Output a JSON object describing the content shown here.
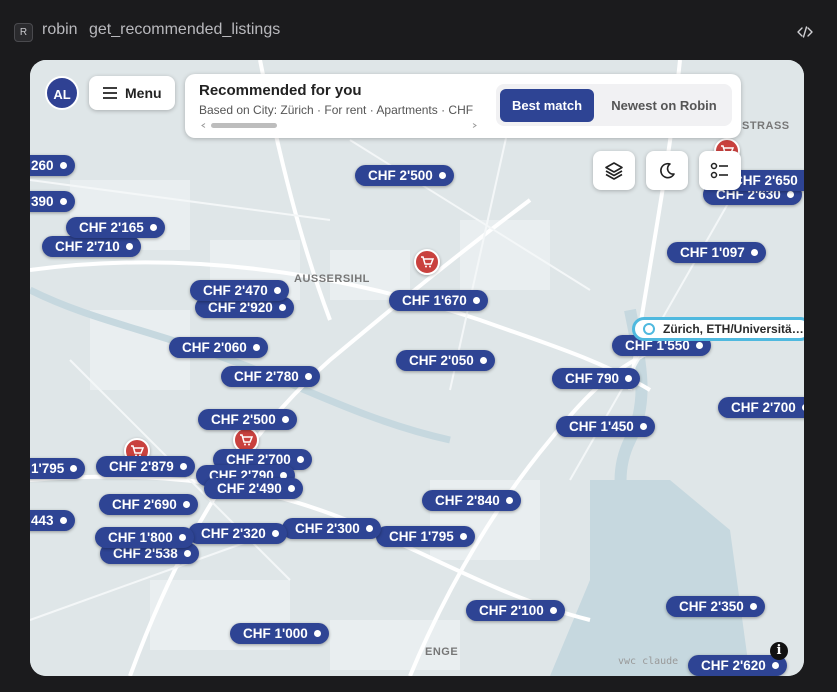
{
  "app": {
    "badge": "R",
    "name": "robin",
    "tool": "get_recommended_listings"
  },
  "map": {
    "avatar_initials": "AL",
    "menu_label": "Menu",
    "recommended": {
      "title": "Recommended for you",
      "subtitle": "Based on City: Zürich · For rent · Apartments · CHF"
    },
    "sort": {
      "active": "Best match",
      "other": "Newest on Robin"
    },
    "location_label": "Zürich, ETH/Universitä…",
    "areas": [
      "AUSSERSIHL",
      "ENGE",
      "STRASS"
    ],
    "attribution": "vwc claude",
    "price_pins": [
      "CHF 2'500",
      "CHF 1'670",
      "CHF 2'050",
      "CHF 1'550",
      "CHF 790",
      "CHF 1'450",
      "CHF 2'840",
      "CHF 1'795",
      "CHF 2'100",
      "CHF 1'000",
      "CHF 2'300",
      "CHF 2'320",
      "CHF 2'538",
      "CHF 1'800",
      "CHF 2'690",
      "CHF 2'879",
      "CHF 2'700",
      "CHF 2'790",
      "CHF 2'490",
      "CHF 2'500",
      "CHF 2'780",
      "CHF 2'060",
      "CHF 2'920",
      "CHF 2'470",
      "CHF 2'710",
      "CHF 2'165",
      "CHF 1'097",
      "CHF 2'630",
      "CHF 2'650",
      "CHF 2'700",
      "CHF 2'350",
      "CHF 2'620",
      "260",
      "390",
      "1'795",
      "443"
    ],
    "colors": {
      "pin": "#2e4494",
      "location": "#4fb9df",
      "shop": "#c9413e"
    }
  }
}
